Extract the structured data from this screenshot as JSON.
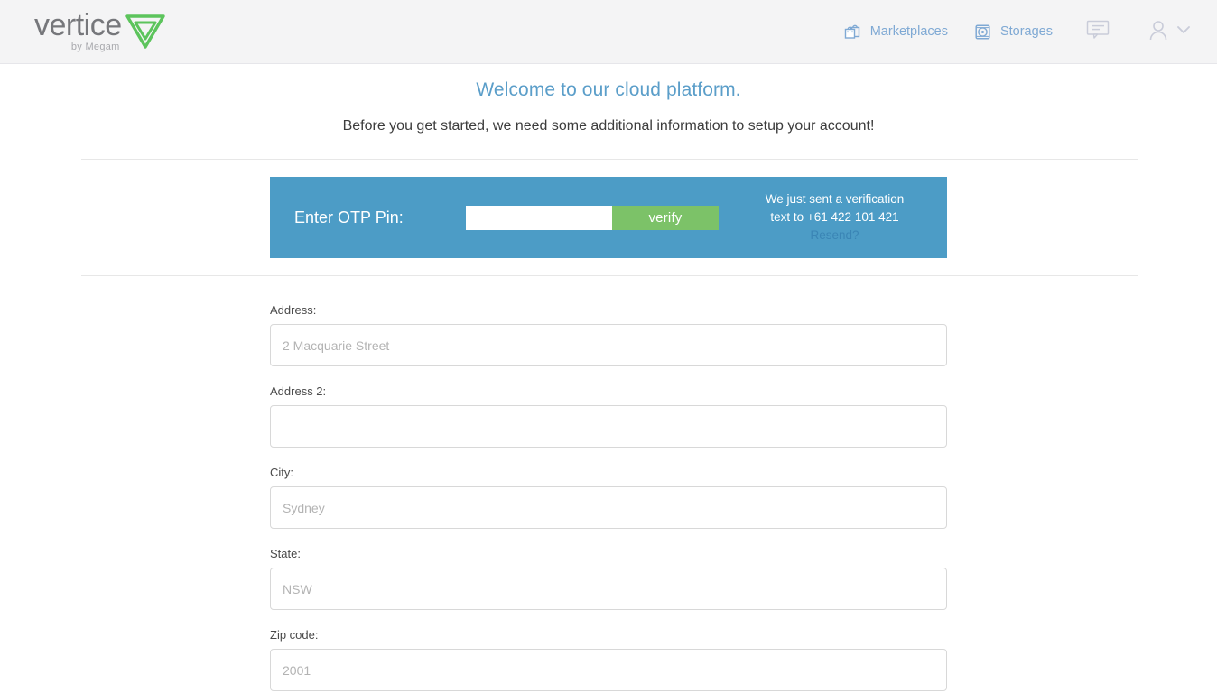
{
  "header": {
    "brand": {
      "name": "vertice",
      "tagline": "by Megam",
      "mark": "triangle-logo",
      "accent": "#5cc45c"
    },
    "nav": [
      {
        "label": "Marketplaces",
        "icon": "marketplaces-icon"
      },
      {
        "label": "Storages",
        "icon": "storages-icon"
      }
    ],
    "messages_icon": "speech-bubble-icon",
    "user_icon": "user-avatar-icon",
    "user_chevron": "chevron-down-icon",
    "nav_color": "#7fa9d4",
    "background": "#f4f4f5"
  },
  "main": {
    "title": "Welcome to our cloud platform.",
    "subtitle": "Before you get started, we need some additional information to setup your account!",
    "title_color": "#5b9ec9"
  },
  "otp": {
    "label": "Enter OTP Pin:",
    "input_value": "",
    "input_placeholder": "",
    "verify_label": "verify",
    "note_line1": "We just sent a verification",
    "note_line2": "text to +61 422 101 421",
    "resend_label": "Resend?",
    "phone": "+61 422 101 421",
    "panel_color": "#4c9cc6",
    "verify_color": "#7cc268",
    "resend_color": "#3a85b5"
  },
  "form": {
    "fields": [
      {
        "label": "Address:",
        "value": "",
        "placeholder": "2 Macquarie Street"
      },
      {
        "label": "Address 2:",
        "value": "",
        "placeholder": ""
      },
      {
        "label": "City:",
        "value": "",
        "placeholder": "Sydney"
      },
      {
        "label": "State:",
        "value": "",
        "placeholder": "NSW"
      },
      {
        "label": "Zip code:",
        "value": "",
        "placeholder": "2001"
      }
    ]
  }
}
